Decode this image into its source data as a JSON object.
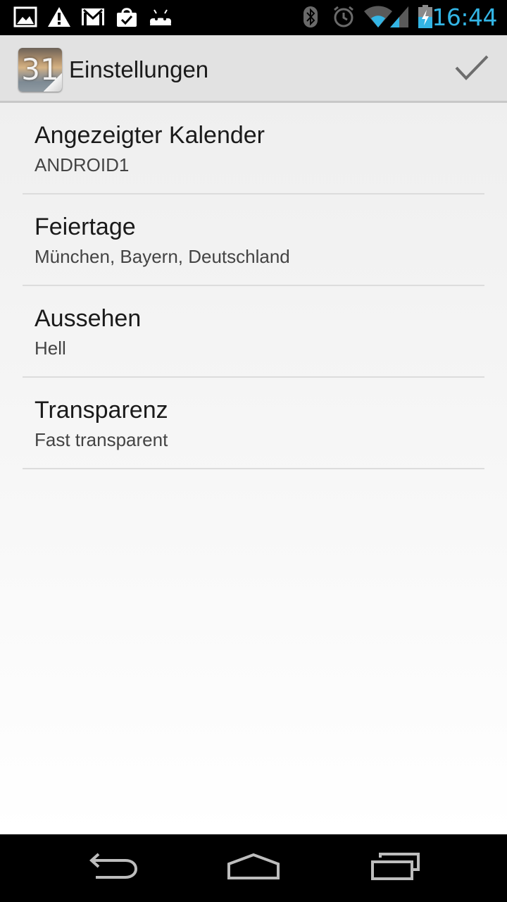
{
  "status_bar": {
    "time": "16:44",
    "notification_icons": [
      "image-icon",
      "warning-icon",
      "gmail-icon",
      "shopping-bag-icon",
      "android-icon"
    ],
    "system_icons": [
      "bluetooth-icon",
      "alarm-icon",
      "wifi-icon",
      "signal-icon",
      "battery-charging-icon"
    ],
    "clock_color": "#33b5e5"
  },
  "action_bar": {
    "app_icon": "calendar-app-icon",
    "app_icon_number": "31",
    "title": "Einstellungen",
    "done_icon": "checkmark-icon"
  },
  "preferences": [
    {
      "title": "Angezeigter Kalender",
      "summary": "ANDROID1"
    },
    {
      "title": "Feiertage",
      "summary": "München, Bayern, Deutschland"
    },
    {
      "title": "Aussehen",
      "summary": "Hell"
    },
    {
      "title": "Transparenz",
      "summary": "Fast transparent"
    }
  ],
  "nav_bar": {
    "buttons": [
      "back-icon",
      "home-icon",
      "recent-apps-icon"
    ]
  }
}
